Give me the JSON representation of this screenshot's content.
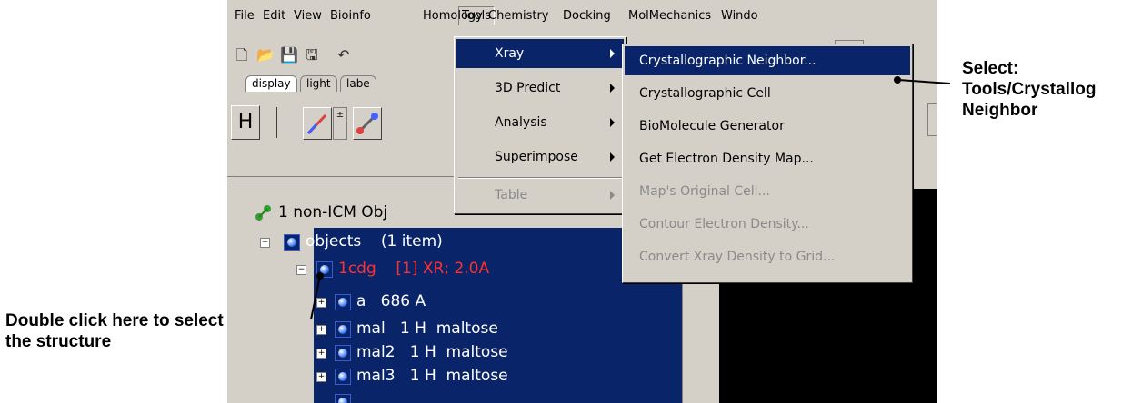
{
  "menubar": {
    "items": [
      "File",
      "Edit",
      "View",
      "Bioinfo",
      "Tools",
      "Homology",
      "Chemistry",
      "Docking",
      "MolMechanics",
      "Windo"
    ]
  },
  "tabs": [
    "display",
    "light",
    "labe"
  ],
  "toolbar2": {
    "h_label": "H"
  },
  "object_header": "1 non-ICM Obj",
  "tree": [
    {
      "name": "objects",
      "detail": "(1 item)",
      "color": "#ffffff"
    },
    {
      "name": "1cdg",
      "detail": "[1] XR; 2.0A",
      "color": "#ff3030"
    },
    {
      "name": "a",
      "detail": "686 A",
      "color": "#ffffff"
    },
    {
      "name": "mal",
      "detail": "1 H  maltose",
      "color": "#ffffff"
    },
    {
      "name": "mal2",
      "detail": "1 H  maltose",
      "color": "#ffffff"
    },
    {
      "name": "mal3",
      "detail": "1 H  maltose",
      "color": "#ffffff"
    }
  ],
  "tools_menu": [
    {
      "label": "Xray",
      "state": "selected"
    },
    {
      "label": "3D Predict",
      "state": "normal"
    },
    {
      "label": "Analysis",
      "state": "normal"
    },
    {
      "label": "Superimpose",
      "state": "normal"
    },
    {
      "label": "Table",
      "state": "disabled"
    }
  ],
  "xray_menu": [
    {
      "label": "Crystallographic Neighbor...",
      "state": "selected"
    },
    {
      "label": "Crystallographic Cell",
      "state": "normal"
    },
    {
      "label": "BioMolecule Generator",
      "state": "normal"
    },
    {
      "label": "Get Electron Density Map...",
      "state": "normal"
    },
    {
      "label": "Map's Original Cell...",
      "state": "disabled"
    },
    {
      "label": "Contour Electron Density...",
      "state": "disabled"
    },
    {
      "label": "Convert Xray Density to Grid...",
      "state": "disabled"
    }
  ],
  "callouts": {
    "right_line1": "Select:",
    "right_line2": "Tools/Crystallog",
    "right_line3": "Neighbor",
    "left_line1": "Double click here to select",
    "left_line2": "the structure"
  },
  "colors": {
    "selection": "#0a246a",
    "panel": "#d4d0c8",
    "disabled": "#8a8a8a",
    "red_text": "#ff3030"
  }
}
